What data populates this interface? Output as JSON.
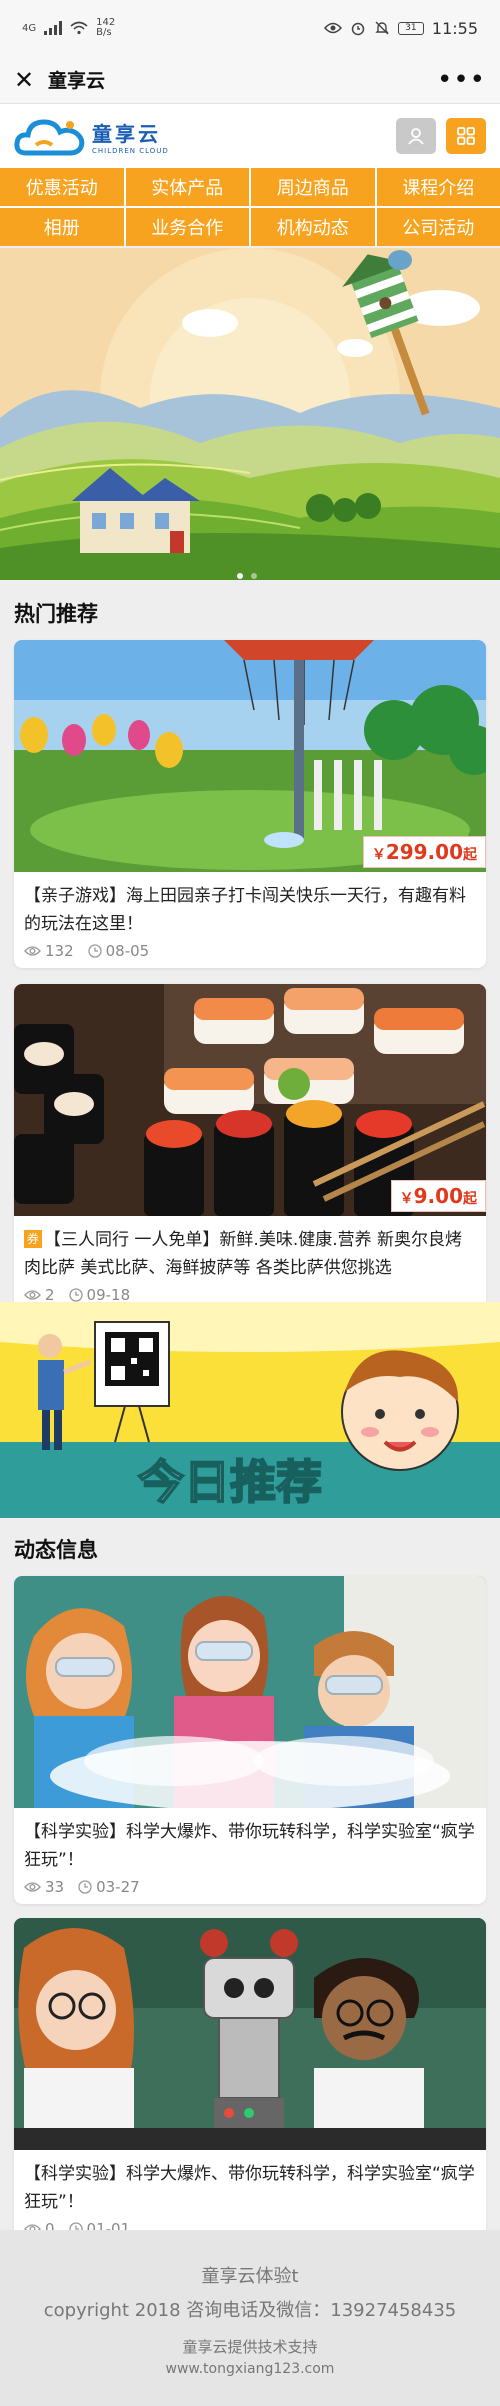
{
  "status_bar": {
    "network": "4G",
    "speed": "142",
    "speed_unit": "B/s",
    "battery": "31",
    "time": "11:55"
  },
  "titlebar": {
    "title": "童享云"
  },
  "header": {
    "logo_cn": "童享云",
    "logo_en": "CHILDREN CLOUD"
  },
  "nav": {
    "items": [
      "优惠活动",
      "实体产品",
      "周边商品",
      "课程介绍",
      "相册",
      "业务合作",
      "机构动态",
      "公司活动"
    ]
  },
  "hot": {
    "title": "热门推荐",
    "cards": [
      {
        "price_symbol": "￥",
        "price": "299.00",
        "price_suffix": "起",
        "text": "【亲子游戏】海上田园亲子打卡闯关快乐一天行，有趣有料的玩法在这里！",
        "views": "132",
        "date": "08-05"
      },
      {
        "price_symbol": "￥",
        "price": "9.00",
        "price_suffix": "起",
        "coupon": "券",
        "text": "【三人同行 一人免单】新鲜.美味.健康.营养 新奥尔良烤肉比萨 美式比萨、海鲜披萨等 各类比萨供您挑选",
        "views": "2",
        "date": "09-18"
      }
    ]
  },
  "promo": {
    "text": "今日推荐"
  },
  "news": {
    "title": "动态信息",
    "cards": [
      {
        "text": "【科学实验】科学大爆炸、带你玩转科学，科学实验室“疯学狂玩”！",
        "views": "33",
        "date": "03-27"
      },
      {
        "text": "【科学实验】科学大爆炸、带你玩转科学，科学实验室“疯学狂玩”！",
        "views": "0",
        "date": "01-01"
      }
    ]
  },
  "footer": {
    "line1": "童享云体验t",
    "line2": "copyright 2018 咨询电话及微信：13927458435",
    "line3": "童享云提供技术支持",
    "line4": "www.tongxiang123.com"
  },
  "colors": {
    "accent": "#f7a320",
    "price": "#e03a1c",
    "brand_blue": "#1a5fb5"
  }
}
